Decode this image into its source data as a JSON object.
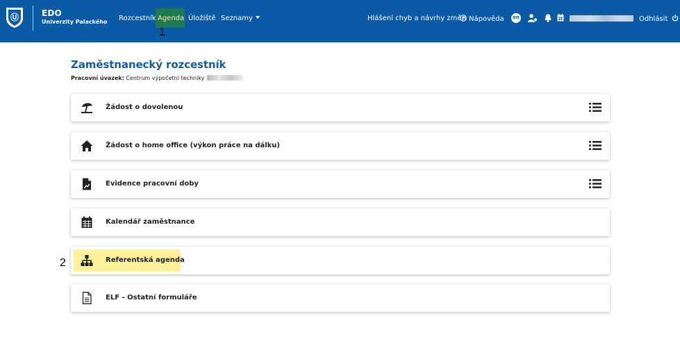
{
  "header": {
    "brand_title": "EDO",
    "brand_subtitle": "Univerzity Palackého",
    "nav": [
      {
        "label": "Rozcestník"
      },
      {
        "label": "Agenda"
      },
      {
        "label": "Úložiště"
      },
      {
        "label": "Seznamy"
      }
    ],
    "report_link": "Hlášení chyb a návrhy změn",
    "help_link": "Nápověda",
    "language": "en",
    "logout": "Odhlásit",
    "icons": [
      "university-logo",
      "help-icon",
      "user-settings-icon",
      "bell-icon",
      "calendar-icon",
      "power-icon"
    ],
    "colors": {
      "bar": "#0a5aa6",
      "active_item_bg": "#1f7a53",
      "active_item_text": "#ffe89a"
    }
  },
  "markers": [
    "1",
    "2"
  ],
  "main": {
    "title": "Zaměstnanecký rozcestník",
    "workload_label": "Pracovní úvazek:",
    "workload_value": "Centrum výpočetní techniky",
    "cards": [
      {
        "label": "Žádost o dovolenou",
        "icon": "beach-umbrella-icon",
        "has_list": true
      },
      {
        "label": "Žádost o home office (výkon práce na dálku)",
        "icon": "home-icon",
        "has_list": true
      },
      {
        "label": "Evidence pracovní doby",
        "icon": "document-chart-icon",
        "has_list": true
      },
      {
        "label": "Kalendář zaměstnance",
        "icon": "calendar-icon",
        "has_list": false
      },
      {
        "label": "Referentská agenda",
        "icon": "org-chart-icon",
        "has_list": false,
        "highlighted": true
      },
      {
        "label": "ELF - Ostatní formuláře",
        "icon": "document-icon",
        "has_list": false
      }
    ],
    "colors": {
      "title": "#145ca3",
      "highlight": "#fff29b"
    }
  }
}
